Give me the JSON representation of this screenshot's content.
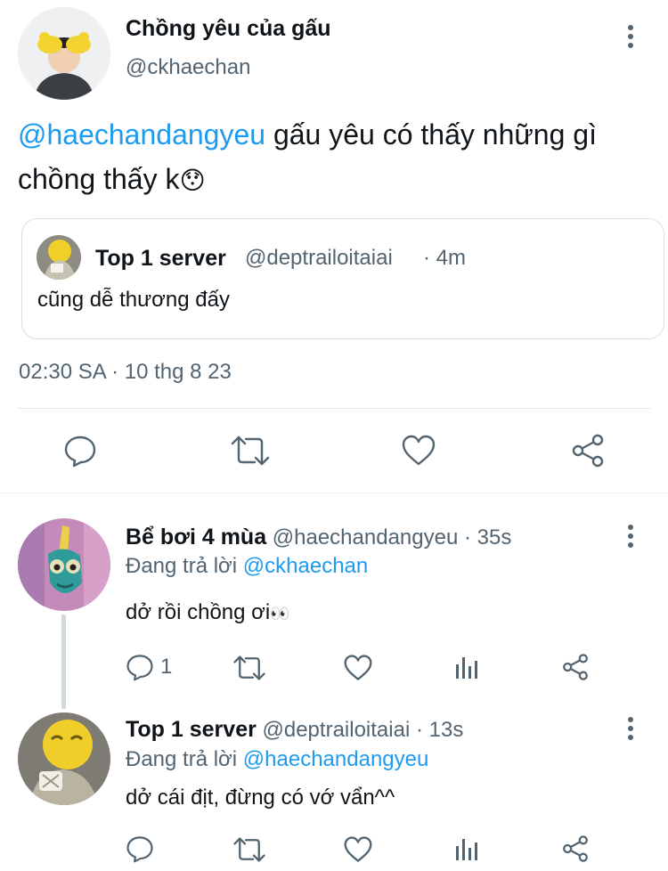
{
  "main_tweet": {
    "display_name": "Chồng yêu của gấu",
    "handle": "@ckhaechan",
    "mention": "@haechandangyeu",
    "text_part1": " gấu yêu có thấy những gì",
    "text_part2": "chồng thấy k",
    "emoji": "😯",
    "timestamp": "02:30 SA · 10 thg 8 23"
  },
  "quoted_tweet": {
    "display_name": "Top 1 server",
    "handle": "@deptrailoitaiai",
    "time": "· 4m",
    "text": "cũng dễ thương đấy"
  },
  "replies": [
    {
      "display_name": "Bể bơi 4 mùa",
      "handle": "@haechandangyeu",
      "time": "· 35s",
      "replying_prefix": "Đang trả lời",
      "replying_to": "@ckhaechan",
      "text": "dở rồi chồng ơi",
      "emoji": "👀",
      "reply_count": "1"
    },
    {
      "display_name": "Top 1 server",
      "handle": "@deptrailoitaiai",
      "time": "· 13s",
      "replying_prefix": "Đang trả lời",
      "replying_to": "@haechandangyeu",
      "text": "dở cái địt, đừng có vớ vẩn^^"
    }
  ],
  "colors": {
    "accent": "#1d9bf0",
    "muted": "#536471",
    "text": "#0f1419",
    "divider": "#e6e9ec"
  }
}
